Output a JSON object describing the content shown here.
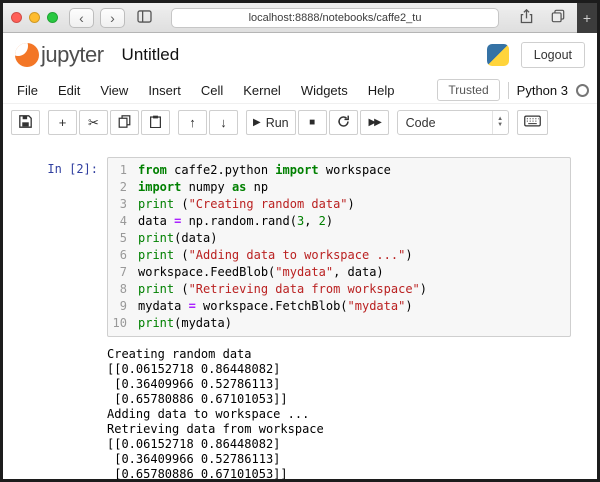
{
  "browser": {
    "url": "localhost:8888/notebooks/caffe2_tu",
    "new_tab": "+"
  },
  "icons": {
    "back": "‹",
    "forward": "›",
    "add": "+",
    "cut": "✂",
    "move_up": "↑",
    "move_down": "↓",
    "run": "▶",
    "stop": "■",
    "fast_forward": "▶▶",
    "stepper_up": "▲",
    "stepper_down": "▼"
  },
  "header": {
    "logo_text": "jupyter",
    "title": "Untitled",
    "logout_label": "Logout"
  },
  "menu": {
    "items": [
      "File",
      "Edit",
      "View",
      "Insert",
      "Cell",
      "Kernel",
      "Widgets",
      "Help"
    ],
    "trusted_label": "Trusted",
    "kernel_name": "Python 3"
  },
  "toolbar": {
    "run_label": "Run",
    "cell_type": "Code"
  },
  "colors": {
    "keyword": "#008000",
    "builtin": "#008000",
    "string": "#BA2121",
    "number": "#008000",
    "operator": "#AA22FF",
    "prompt": "#303F9F",
    "jupyter_orange": "#F37626"
  },
  "cell": {
    "prompt": "In [2]:",
    "lines": [
      {
        "n": "1",
        "tokens": [
          {
            "t": "kw",
            "v": "from"
          },
          {
            "t": "plain",
            "v": " caffe2.python "
          },
          {
            "t": "kw",
            "v": "import"
          },
          {
            "t": "plain",
            "v": " workspace"
          }
        ]
      },
      {
        "n": "2",
        "tokens": [
          {
            "t": "kw",
            "v": "import"
          },
          {
            "t": "plain",
            "v": " numpy "
          },
          {
            "t": "kw",
            "v": "as"
          },
          {
            "t": "plain",
            "v": " np"
          }
        ]
      },
      {
        "n": "3",
        "tokens": [
          {
            "t": "builtin",
            "v": "print"
          },
          {
            "t": "plain",
            "v": " ("
          },
          {
            "t": "str",
            "v": "\"Creating random data\""
          },
          {
            "t": "plain",
            "v": ")"
          }
        ]
      },
      {
        "n": "4",
        "tokens": [
          {
            "t": "plain",
            "v": "data "
          },
          {
            "t": "op",
            "v": "="
          },
          {
            "t": "plain",
            "v": " np.random.rand("
          },
          {
            "t": "num",
            "v": "3"
          },
          {
            "t": "plain",
            "v": ", "
          },
          {
            "t": "num",
            "v": "2"
          },
          {
            "t": "plain",
            "v": ")"
          }
        ]
      },
      {
        "n": "5",
        "tokens": [
          {
            "t": "builtin",
            "v": "print"
          },
          {
            "t": "plain",
            "v": "(data)"
          }
        ]
      },
      {
        "n": "6",
        "tokens": [
          {
            "t": "builtin",
            "v": "print"
          },
          {
            "t": "plain",
            "v": " ("
          },
          {
            "t": "str",
            "v": "\"Adding data to workspace ...\""
          },
          {
            "t": "plain",
            "v": ")"
          }
        ]
      },
      {
        "n": "7",
        "tokens": [
          {
            "t": "plain",
            "v": "workspace.FeedBlob("
          },
          {
            "t": "str",
            "v": "\"mydata\""
          },
          {
            "t": "plain",
            "v": ", data)"
          }
        ]
      },
      {
        "n": "8",
        "tokens": [
          {
            "t": "builtin",
            "v": "print"
          },
          {
            "t": "plain",
            "v": " ("
          },
          {
            "t": "str",
            "v": "\"Retrieving data from workspace\""
          },
          {
            "t": "plain",
            "v": ")"
          }
        ]
      },
      {
        "n": "9",
        "tokens": [
          {
            "t": "plain",
            "v": "mydata "
          },
          {
            "t": "op",
            "v": "="
          },
          {
            "t": "plain",
            "v": " workspace.FetchBlob("
          },
          {
            "t": "str",
            "v": "\"mydata\""
          },
          {
            "t": "plain",
            "v": ")"
          }
        ]
      },
      {
        "n": "10",
        "tokens": [
          {
            "t": "builtin",
            "v": "print"
          },
          {
            "t": "plain",
            "v": "(mydata)"
          }
        ]
      }
    ]
  },
  "output": {
    "lines": [
      "Creating random data",
      "[[0.06152718 0.86448082]",
      " [0.36409966 0.52786113]",
      " [0.65780886 0.67101053]]",
      "Adding data to workspace ...",
      "Retrieving data from workspace",
      "[[0.06152718 0.86448082]",
      " [0.36409966 0.52786113]",
      " [0.65780886 0.67101053]]"
    ]
  }
}
